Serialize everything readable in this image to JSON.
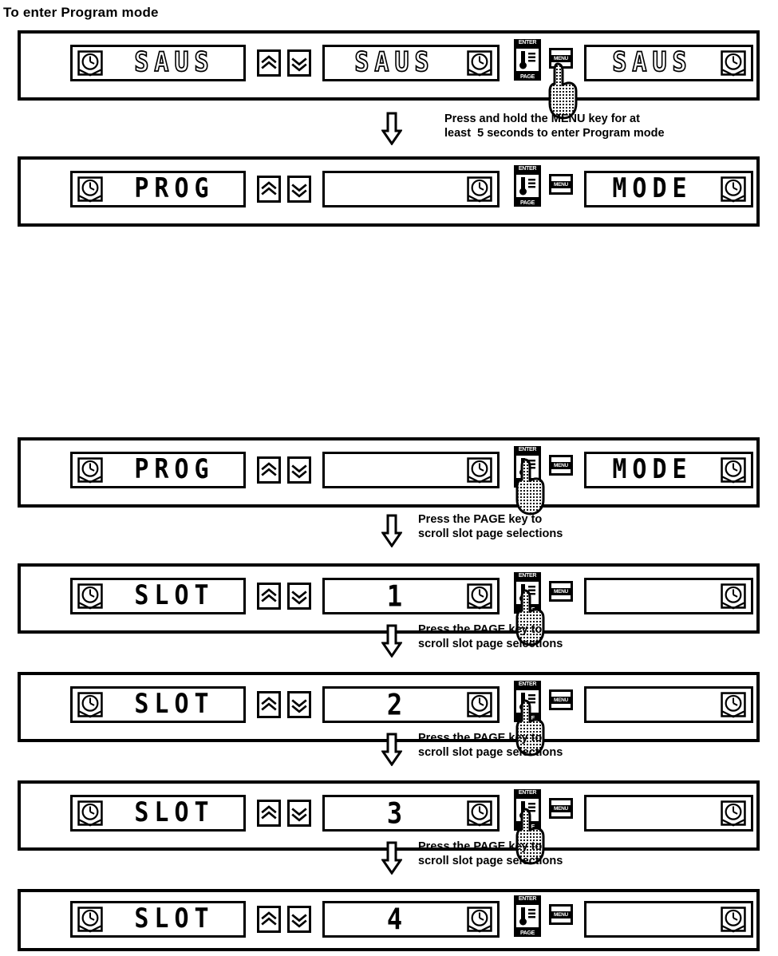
{
  "document": {
    "section_heading": "To enter Program mode"
  },
  "icons": {
    "clock": "clock-icon",
    "up_arrow_key": "double-chevron-up-icon",
    "down_arrow_key": "double-chevron-down-icon",
    "enter_label": "ENTER",
    "page_label": "PAGE",
    "menu_label": "MENU",
    "hand": "pointing-hand-icon",
    "flow_arrow": "down-arrow-icon"
  },
  "colors": {
    "ink": "#000000",
    "background": "#ffffff"
  },
  "sections": [
    {
      "id": "program-mode",
      "heading": "To enter Program mode",
      "steps": [
        {
          "id": "step-saus",
          "left_display": "SAUS",
          "middle_display": "SAUS",
          "right_display": "SAUS",
          "style": "hollow",
          "pressed_key": "menu",
          "instruction": "Press and hold the MENU key for at\nleast  5 seconds to enter Program mode"
        },
        {
          "id": "step-prog",
          "left_display": "PROG",
          "middle_display": "",
          "right_display": "MODE",
          "style": "solid",
          "pressed_key": "none",
          "instruction": ""
        }
      ]
    },
    {
      "id": "slot-pages",
      "heading": "",
      "steps": [
        {
          "id": "step-prog-2",
          "left_display": "PROG",
          "middle_display": "",
          "right_display": "MODE",
          "style": "solid",
          "pressed_key": "page",
          "instruction": "Press the PAGE key to\nscroll slot page selections"
        },
        {
          "id": "step-slot-1",
          "left_display": "SLOT",
          "middle_display": "1",
          "right_display": "",
          "style": "solid",
          "pressed_key": "page",
          "instruction": "Press the PAGE key to\nscroll slot page selections"
        },
        {
          "id": "step-slot-2",
          "left_display": "SLOT",
          "middle_display": "2",
          "right_display": "",
          "style": "solid",
          "pressed_key": "page",
          "instruction": "Press the PAGE key to\nscroll slot page selections"
        },
        {
          "id": "step-slot-3",
          "left_display": "SLOT",
          "middle_display": "3",
          "right_display": "",
          "style": "solid",
          "pressed_key": "page",
          "instruction": "Press the PAGE key to\nscroll slot page selections"
        },
        {
          "id": "step-slot-4",
          "left_display": "SLOT",
          "middle_display": "4",
          "right_display": "",
          "style": "solid",
          "pressed_key": "none",
          "instruction": ""
        }
      ]
    }
  ]
}
